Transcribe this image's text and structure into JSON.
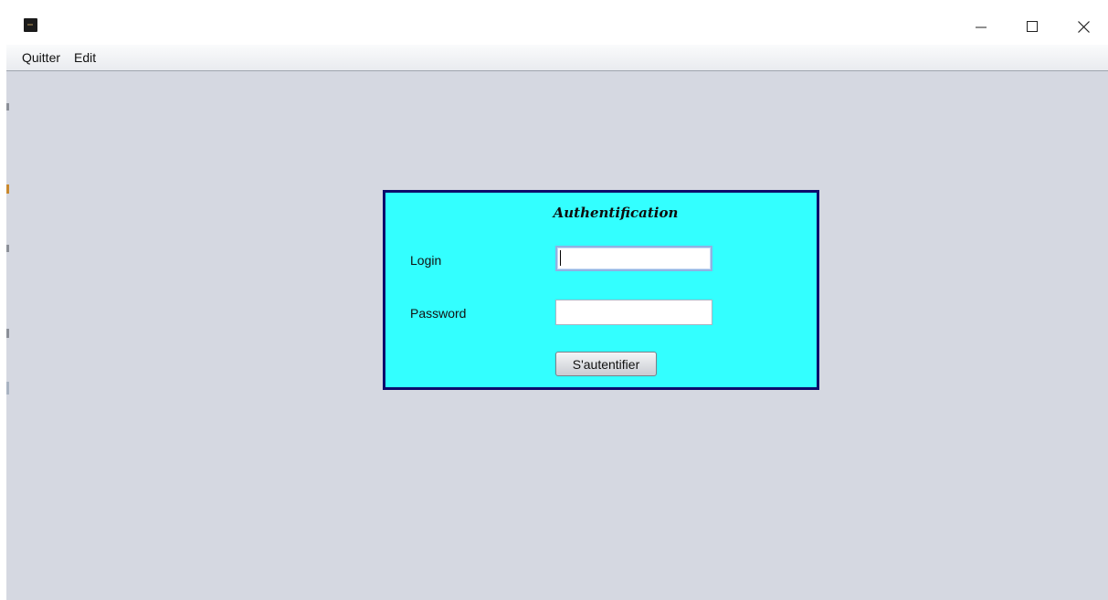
{
  "window": {
    "icon": "java-app-icon",
    "controls": {
      "minimize_icon": "minimize-icon",
      "maximize_icon": "maximize-icon",
      "close_icon": "close-icon"
    }
  },
  "menubar": {
    "items": [
      {
        "label": "Quitter"
      },
      {
        "label": "Edit"
      }
    ]
  },
  "auth_panel": {
    "title": "Authentification",
    "login_label": "Login",
    "login_value": "",
    "password_label": "Password",
    "password_value": "",
    "submit_label": "S'autentifier",
    "colors": {
      "background": "#33ffff",
      "border": "#0c0c6b",
      "window_background": "#d5d8e1"
    }
  }
}
